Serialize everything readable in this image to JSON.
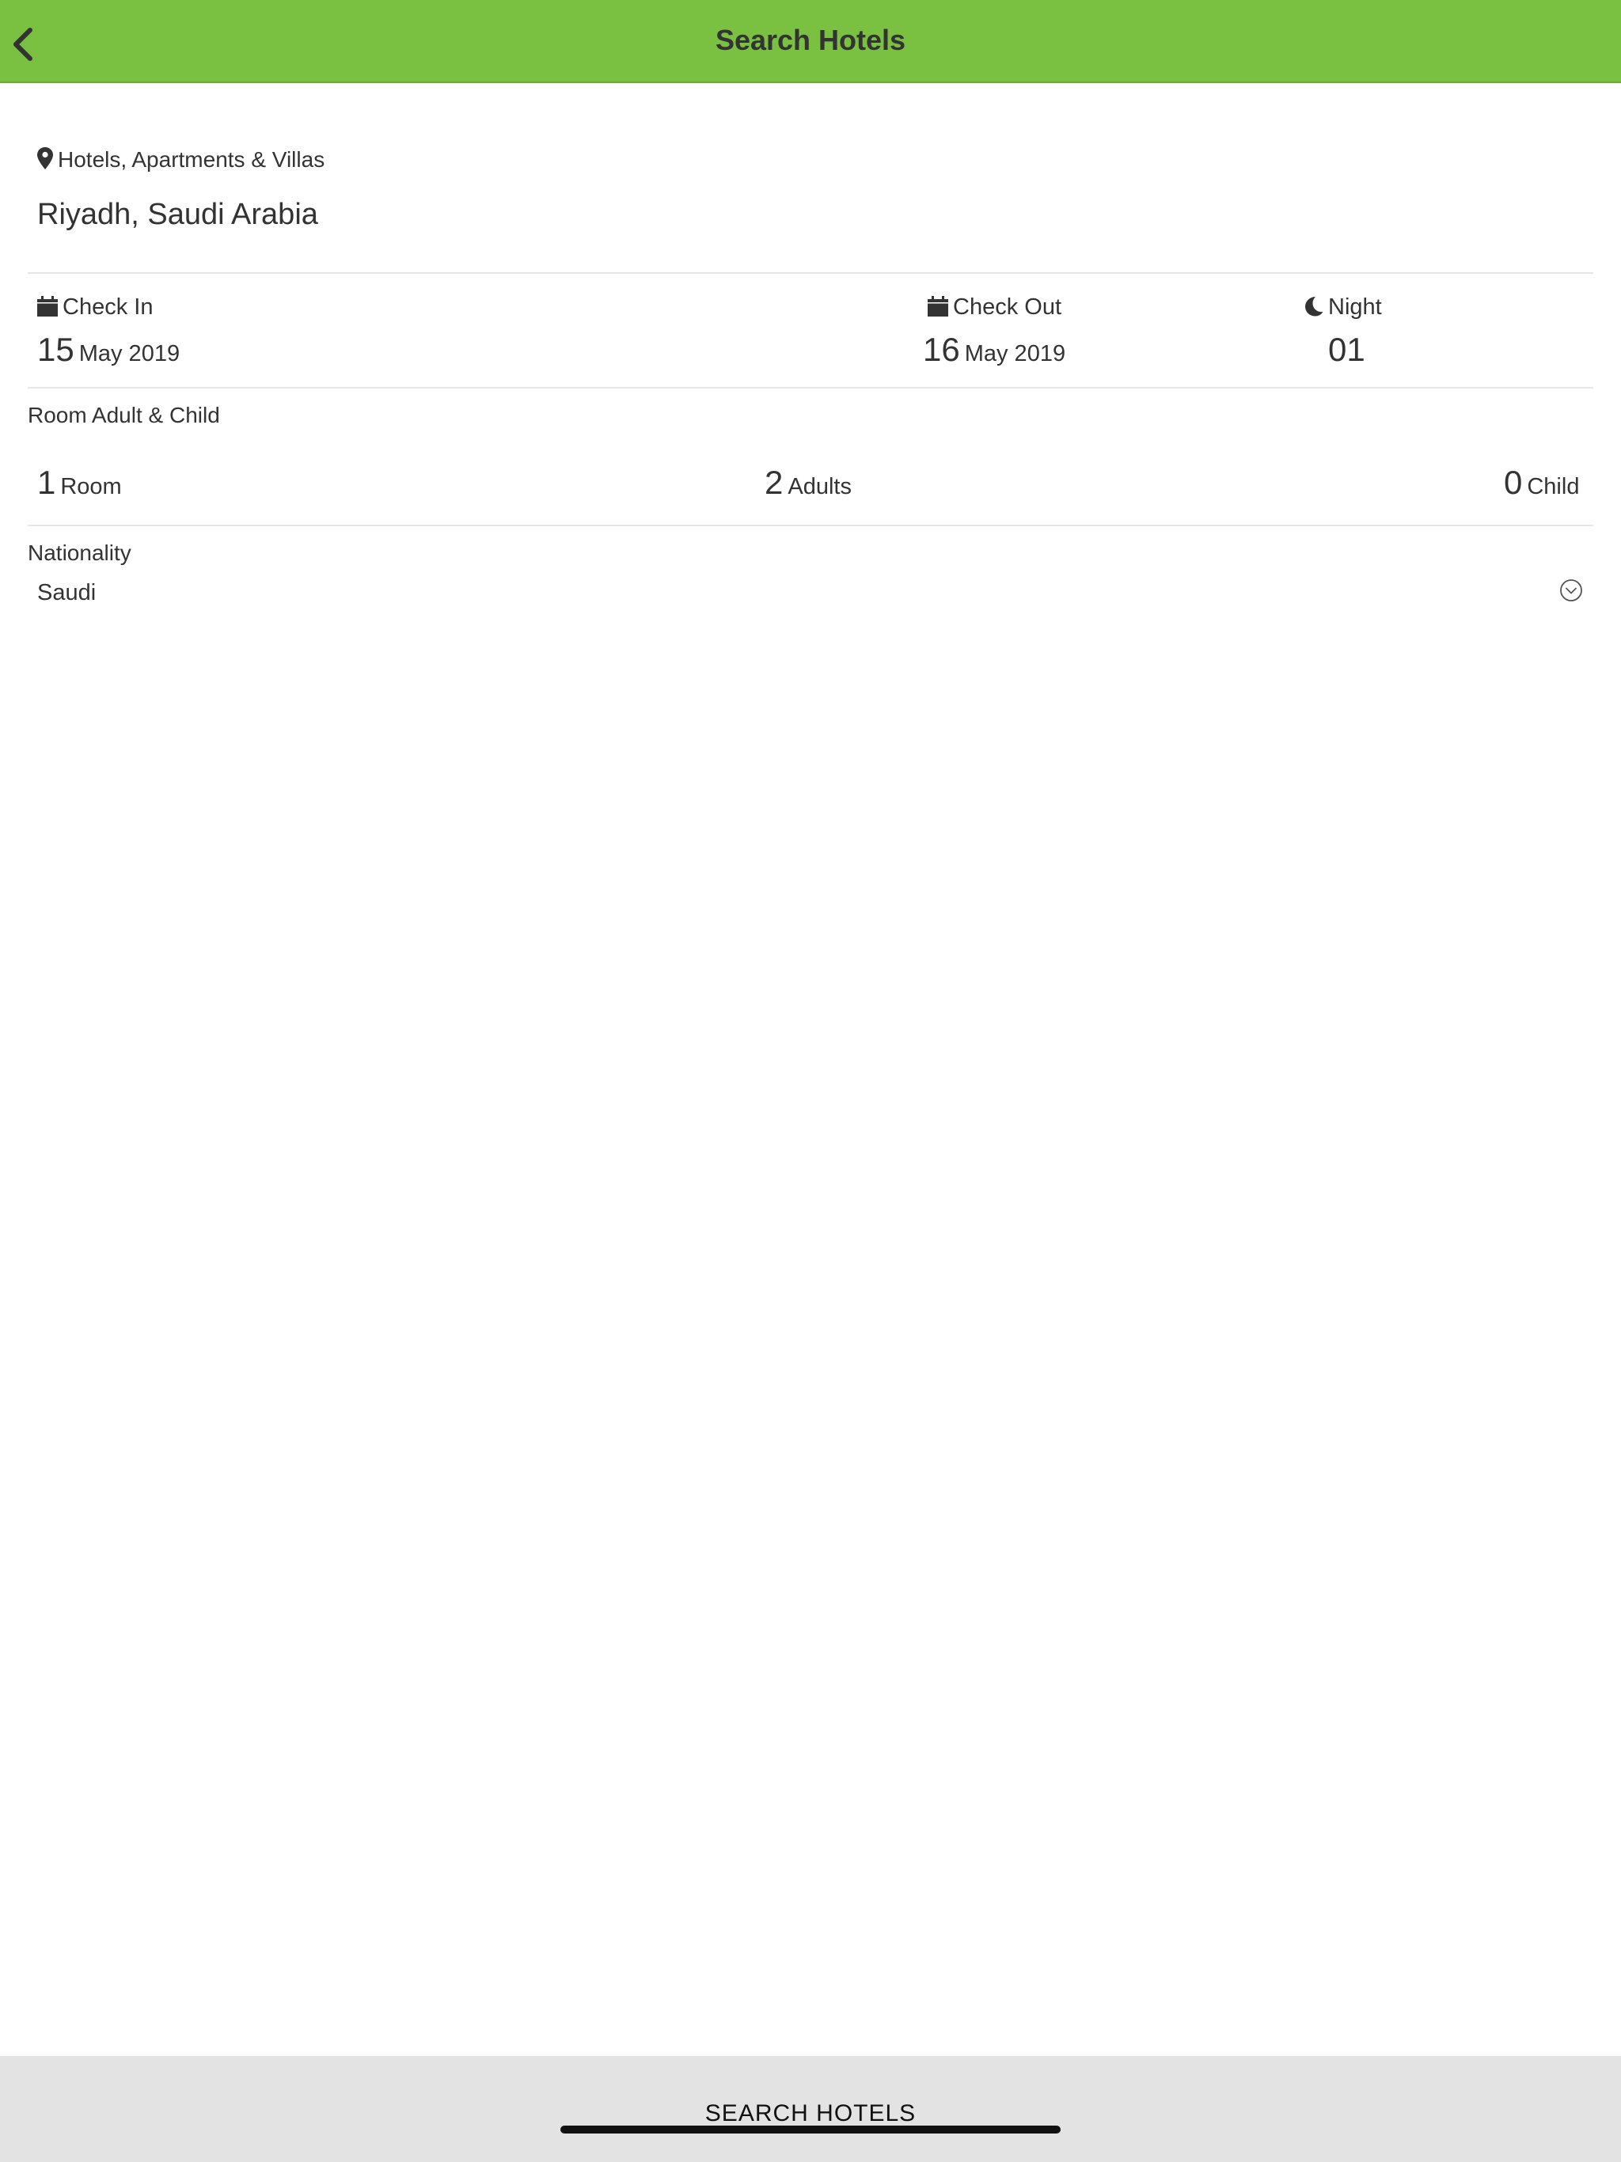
{
  "header": {
    "title": "Search Hotels"
  },
  "location": {
    "type_label": "Hotels, Apartments & Villas",
    "value": "Riyadh, Saudi Arabia"
  },
  "dates": {
    "check_in": {
      "label": "Check In",
      "day": "15",
      "month_year": "May 2019"
    },
    "check_out": {
      "label": "Check Out",
      "day": "16",
      "month_year": "May 2019"
    },
    "night": {
      "label": "Night",
      "value": "01"
    }
  },
  "occupancy": {
    "title": "Room Adult & Child",
    "rooms": {
      "count": "1",
      "label": "Room"
    },
    "adults": {
      "count": "2",
      "label": "Adults"
    },
    "children": {
      "count": "0",
      "label": "Child"
    }
  },
  "nationality": {
    "title": "Nationality",
    "value": "Saudi"
  },
  "footer": {
    "search_label": "SEARCH HOTELS"
  },
  "colors": {
    "header_bg": "#7ac142",
    "footer_bg": "#e3e3e3",
    "text": "#333333"
  }
}
